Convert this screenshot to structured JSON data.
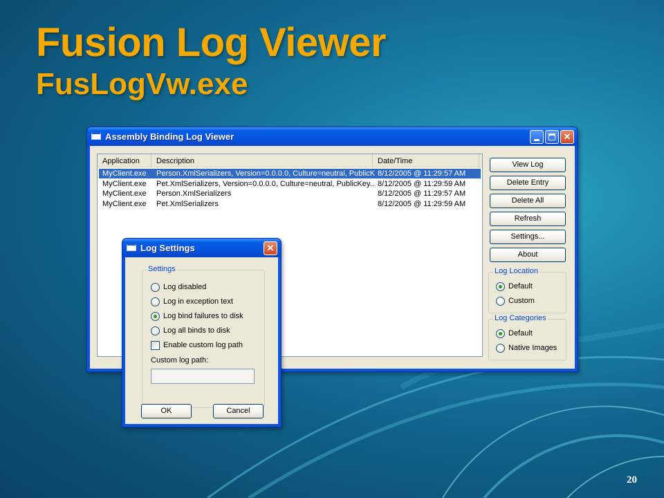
{
  "slide": {
    "title": "Fusion Log Viewer",
    "subtitle": "FusLogVw.exe",
    "page_number": "20"
  },
  "main_window": {
    "title": "Assembly Binding Log Viewer",
    "columns": [
      "Application",
      "Description",
      "Date/Time"
    ],
    "rows": [
      {
        "application": "MyClient.exe",
        "description": "Person.XmlSerializers, Version=0.0.0.0, Culture=neutral, PublicK...",
        "datetime": "8/12/2005 @ 11:29:57 AM",
        "selected": true
      },
      {
        "application": "MyClient.exe",
        "description": "Pet.XmlSerializers, Version=0.0.0.0, Culture=neutral, PublicKey...",
        "datetime": "8/12/2005 @ 11:29:59 AM",
        "selected": false
      },
      {
        "application": "MyClient.exe",
        "description": "Person.XmlSerializers",
        "datetime": "8/12/2005 @ 11:29:57 AM",
        "selected": false
      },
      {
        "application": "MyClient.exe",
        "description": "Pet.XmlSerializers",
        "datetime": "8/12/2005 @ 11:29:59 AM",
        "selected": false
      }
    ],
    "buttons": {
      "view_log": "View Log",
      "delete_entry": "Delete Entry",
      "delete_all": "Delete All",
      "refresh": "Refresh",
      "settings": "Settings...",
      "about": "About"
    },
    "log_location": {
      "label": "Log Location",
      "options": [
        {
          "label": "Default",
          "checked": true
        },
        {
          "label": "Custom",
          "checked": false
        }
      ]
    },
    "log_categories": {
      "label": "Log Categories",
      "options": [
        {
          "label": "Default",
          "checked": true
        },
        {
          "label": "Native Images",
          "checked": false
        }
      ]
    }
  },
  "settings_dialog": {
    "title": "Log Settings",
    "group_label": "Settings",
    "options": [
      {
        "label": "Log disabled",
        "checked": false
      },
      {
        "label": "Log in exception text",
        "checked": false
      },
      {
        "label": "Log bind failures to disk",
        "checked": true
      },
      {
        "label": "Log all binds to disk",
        "checked": false
      }
    ],
    "custom_path_checkbox": "Enable custom log path",
    "custom_path_label": "Custom log path:",
    "custom_path_value": "",
    "ok": "OK",
    "cancel": "Cancel"
  },
  "colors": {
    "title_accent": "#f5a800",
    "xp_titlebar": "#0553e0",
    "selection": "#316ac5"
  }
}
